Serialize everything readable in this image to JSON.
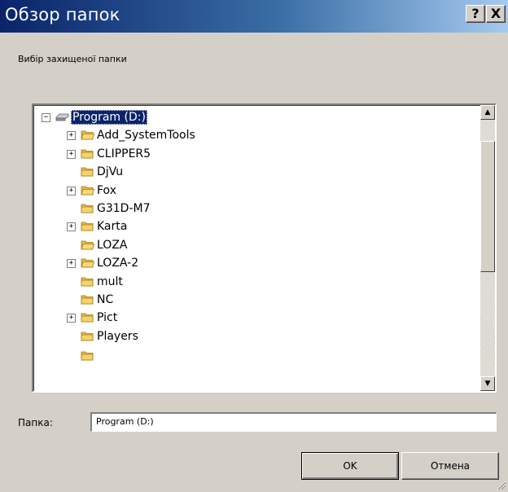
{
  "window": {
    "title": "Обзор папок",
    "help_glyph": "?",
    "close_glyph": "X"
  },
  "description": "Вибір захищеної папки",
  "tree": {
    "root": {
      "label": "Program (D:)",
      "expander": "⊟",
      "selected": true,
      "icon": "drive-icon"
    },
    "items": [
      {
        "label": "Add_SystemTools",
        "expandable": true,
        "open_folder": true
      },
      {
        "label": "CLIPPER5",
        "expandable": true,
        "open_folder": false
      },
      {
        "label": "DjVu",
        "expandable": false,
        "open_folder": false
      },
      {
        "label": "Fox",
        "expandable": true,
        "open_folder": true
      },
      {
        "label": "G31D-M7",
        "expandable": false,
        "open_folder": false
      },
      {
        "label": "Karta",
        "expandable": true,
        "open_folder": false
      },
      {
        "label": "LOZA",
        "expandable": false,
        "open_folder": true
      },
      {
        "label": "LOZA-2",
        "expandable": true,
        "open_folder": true
      },
      {
        "label": "mult",
        "expandable": false,
        "open_folder": false
      },
      {
        "label": "NC",
        "expandable": false,
        "open_folder": false
      },
      {
        "label": "Pict",
        "expandable": true,
        "open_folder": false
      },
      {
        "label": "Players",
        "expandable": false,
        "open_folder": false
      }
    ],
    "plus_glyph": "+",
    "minus_glyph": "−"
  },
  "scrollbar": {
    "up_glyph": "▲",
    "down_glyph": "▼"
  },
  "folder_field": {
    "label": "Папка:",
    "value": "Program (D:)"
  },
  "buttons": {
    "ok": "OK",
    "cancel": "Отмена"
  },
  "colors": {
    "title_gradient_start": "#0a246a",
    "title_gradient_end": "#a6caf0",
    "dialog_bg": "#d4d0c8",
    "selection": "#0a246a",
    "folder_yellow": "#f0c850"
  }
}
